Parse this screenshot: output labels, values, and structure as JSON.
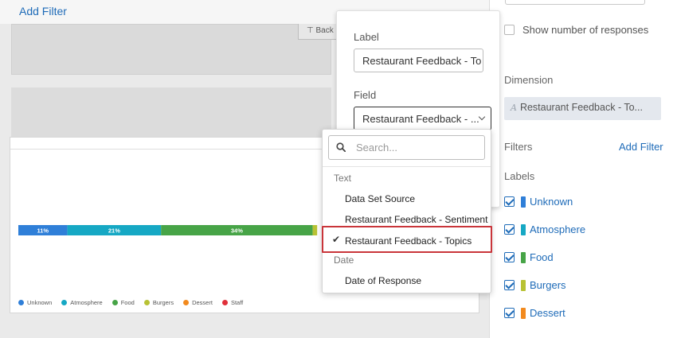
{
  "header": {
    "add_filter": "Add Filter"
  },
  "widget_back": {
    "label": "⊤ Back"
  },
  "chart_data": {
    "type": "bar",
    "orientation": "horizontal-stacked",
    "categories": [
      "Unknown",
      "Atmosphere",
      "Food",
      "Burgers",
      "Dessert",
      "Staff"
    ],
    "series": [
      {
        "name": "Unknown",
        "value": 11,
        "label": "11%",
        "color": "#2f7fd8"
      },
      {
        "name": "Atmosphere",
        "value": 21,
        "label": "21%",
        "color": "#16a8c4"
      },
      {
        "name": "Food",
        "value": 34,
        "label": "34%",
        "color": "#47a447"
      },
      {
        "name": "Burgers",
        "value": 1,
        "label": "",
        "color": "#b8c234"
      }
    ],
    "legend": [
      {
        "name": "Unknown",
        "color": "#2f7fd8"
      },
      {
        "name": "Atmosphere",
        "color": "#16a8c4"
      },
      {
        "name": "Food",
        "color": "#47a447"
      },
      {
        "name": "Burgers",
        "color": "#b8c234"
      },
      {
        "name": "Dessert",
        "color": "#f28a1e"
      },
      {
        "name": "Staff",
        "color": "#e0303a"
      }
    ],
    "legend_position": "bottom-left"
  },
  "popover": {
    "label_title": "Label",
    "label_value": "Restaurant Feedback - To",
    "field_title": "Field",
    "field_value": "Restaurant Feedback - ..."
  },
  "dropdown": {
    "search_placeholder": "Search...",
    "groups": [
      {
        "title": "Text",
        "items": [
          "Data Set Source",
          "Restaurant Feedback - Sentiment",
          "Restaurant Feedback - Topics"
        ]
      },
      {
        "title": "Date",
        "items": [
          "Date of Response"
        ]
      }
    ],
    "selected": "Restaurant Feedback - Topics",
    "checkmark": "✔"
  },
  "panel": {
    "show_responses": "Show number of responses",
    "dimension_title": "Dimension",
    "dimension_value": "Restaurant Feedback - To...",
    "dimension_glyph": "A",
    "filters_title": "Filters",
    "add_filter": "Add Filter",
    "labels_title": "Labels",
    "labels": [
      {
        "name": "Unknown",
        "color": "#2f7fd8",
        "checked": true
      },
      {
        "name": "Atmosphere",
        "color": "#16a8c4",
        "checked": true
      },
      {
        "name": "Food",
        "color": "#47a447",
        "checked": true
      },
      {
        "name": "Burgers",
        "color": "#b8c234",
        "checked": true
      },
      {
        "name": "Dessert",
        "color": "#f28a1e",
        "checked": true
      }
    ]
  }
}
